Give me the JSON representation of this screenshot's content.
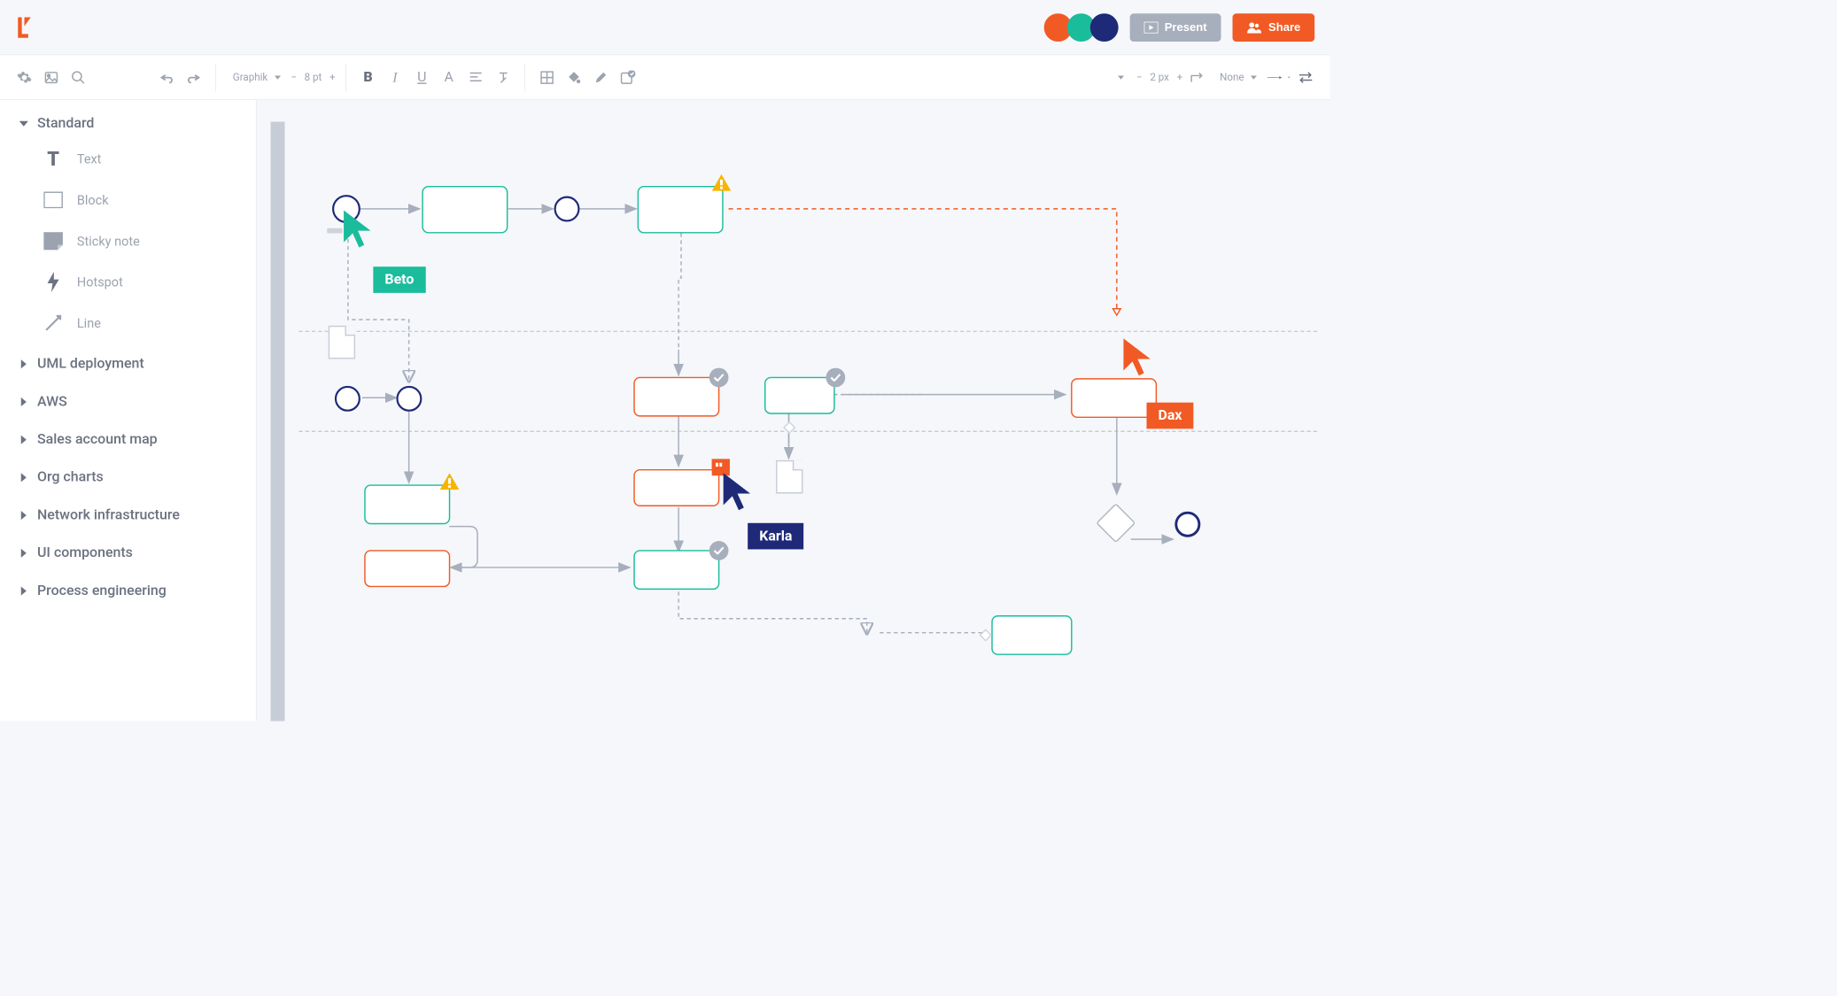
{
  "header": {
    "present_label": "Present",
    "share_label": "Share",
    "presence_colors": [
      "#f15a24",
      "#1abc9c",
      "#1e2a78"
    ]
  },
  "toolbar": {
    "font_name": "Graphik",
    "font_size": "8 pt",
    "line_width": "2 px",
    "line_style": "None"
  },
  "sidebar": {
    "sections": [
      {
        "label": "Standard",
        "expanded": true
      },
      {
        "label": "UML deployment",
        "expanded": false
      },
      {
        "label": "AWS",
        "expanded": false
      },
      {
        "label": "Sales account map",
        "expanded": false
      },
      {
        "label": "Org charts",
        "expanded": false
      },
      {
        "label": "Network infrastructure",
        "expanded": false
      },
      {
        "label": "UI components",
        "expanded": false
      },
      {
        "label": "Process engineering",
        "expanded": false
      }
    ],
    "standard_items": [
      {
        "label": "Text",
        "icon": "text"
      },
      {
        "label": "Block",
        "icon": "block"
      },
      {
        "label": "Sticky note",
        "icon": "sticky"
      },
      {
        "label": "Hotspot",
        "icon": "hotspot"
      },
      {
        "label": "Line",
        "icon": "line"
      }
    ]
  },
  "collaborators": {
    "beto": {
      "name": "Beto",
      "color": "#1abc9c"
    },
    "karla": {
      "name": "Karla",
      "color": "#1e2a78"
    },
    "dax": {
      "name": "Dax",
      "color": "#f15a24"
    }
  }
}
